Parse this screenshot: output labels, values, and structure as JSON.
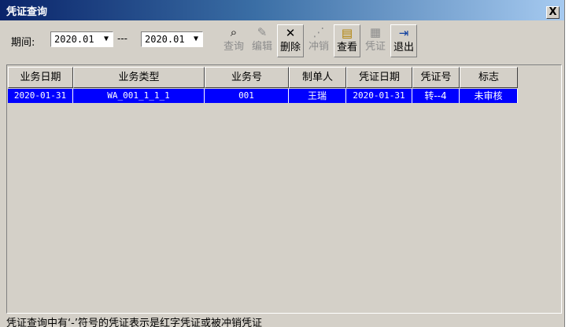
{
  "window": {
    "title": "凭证查询",
    "close_label": "X"
  },
  "filter": {
    "period_label": "期间:",
    "from": "2020.01",
    "separator": "---",
    "to": "2020.01"
  },
  "toolbar": {
    "query": "查询",
    "edit": "编辑",
    "delete": "删除",
    "reverse": "冲销",
    "view": "查看",
    "voucher": "凭证",
    "exit": "退出"
  },
  "table": {
    "columns": [
      "业务日期",
      "业务类型",
      "业务号",
      "制单人",
      "凭证日期",
      "凭证号",
      "标志"
    ],
    "rows": [
      [
        "2020-01-31",
        "WA_001_1_1_1",
        "001",
        "王瑞",
        "2020-01-31",
        "转--4",
        "未审核"
      ]
    ]
  },
  "status": {
    "text": "凭证查询中有‘-’符号的凭证表示是红字凭证或被冲销凭证"
  },
  "colors": {
    "selected_row": "#0000ff",
    "window_bg": "#d4d0c8",
    "title_start": "#0a246a"
  }
}
